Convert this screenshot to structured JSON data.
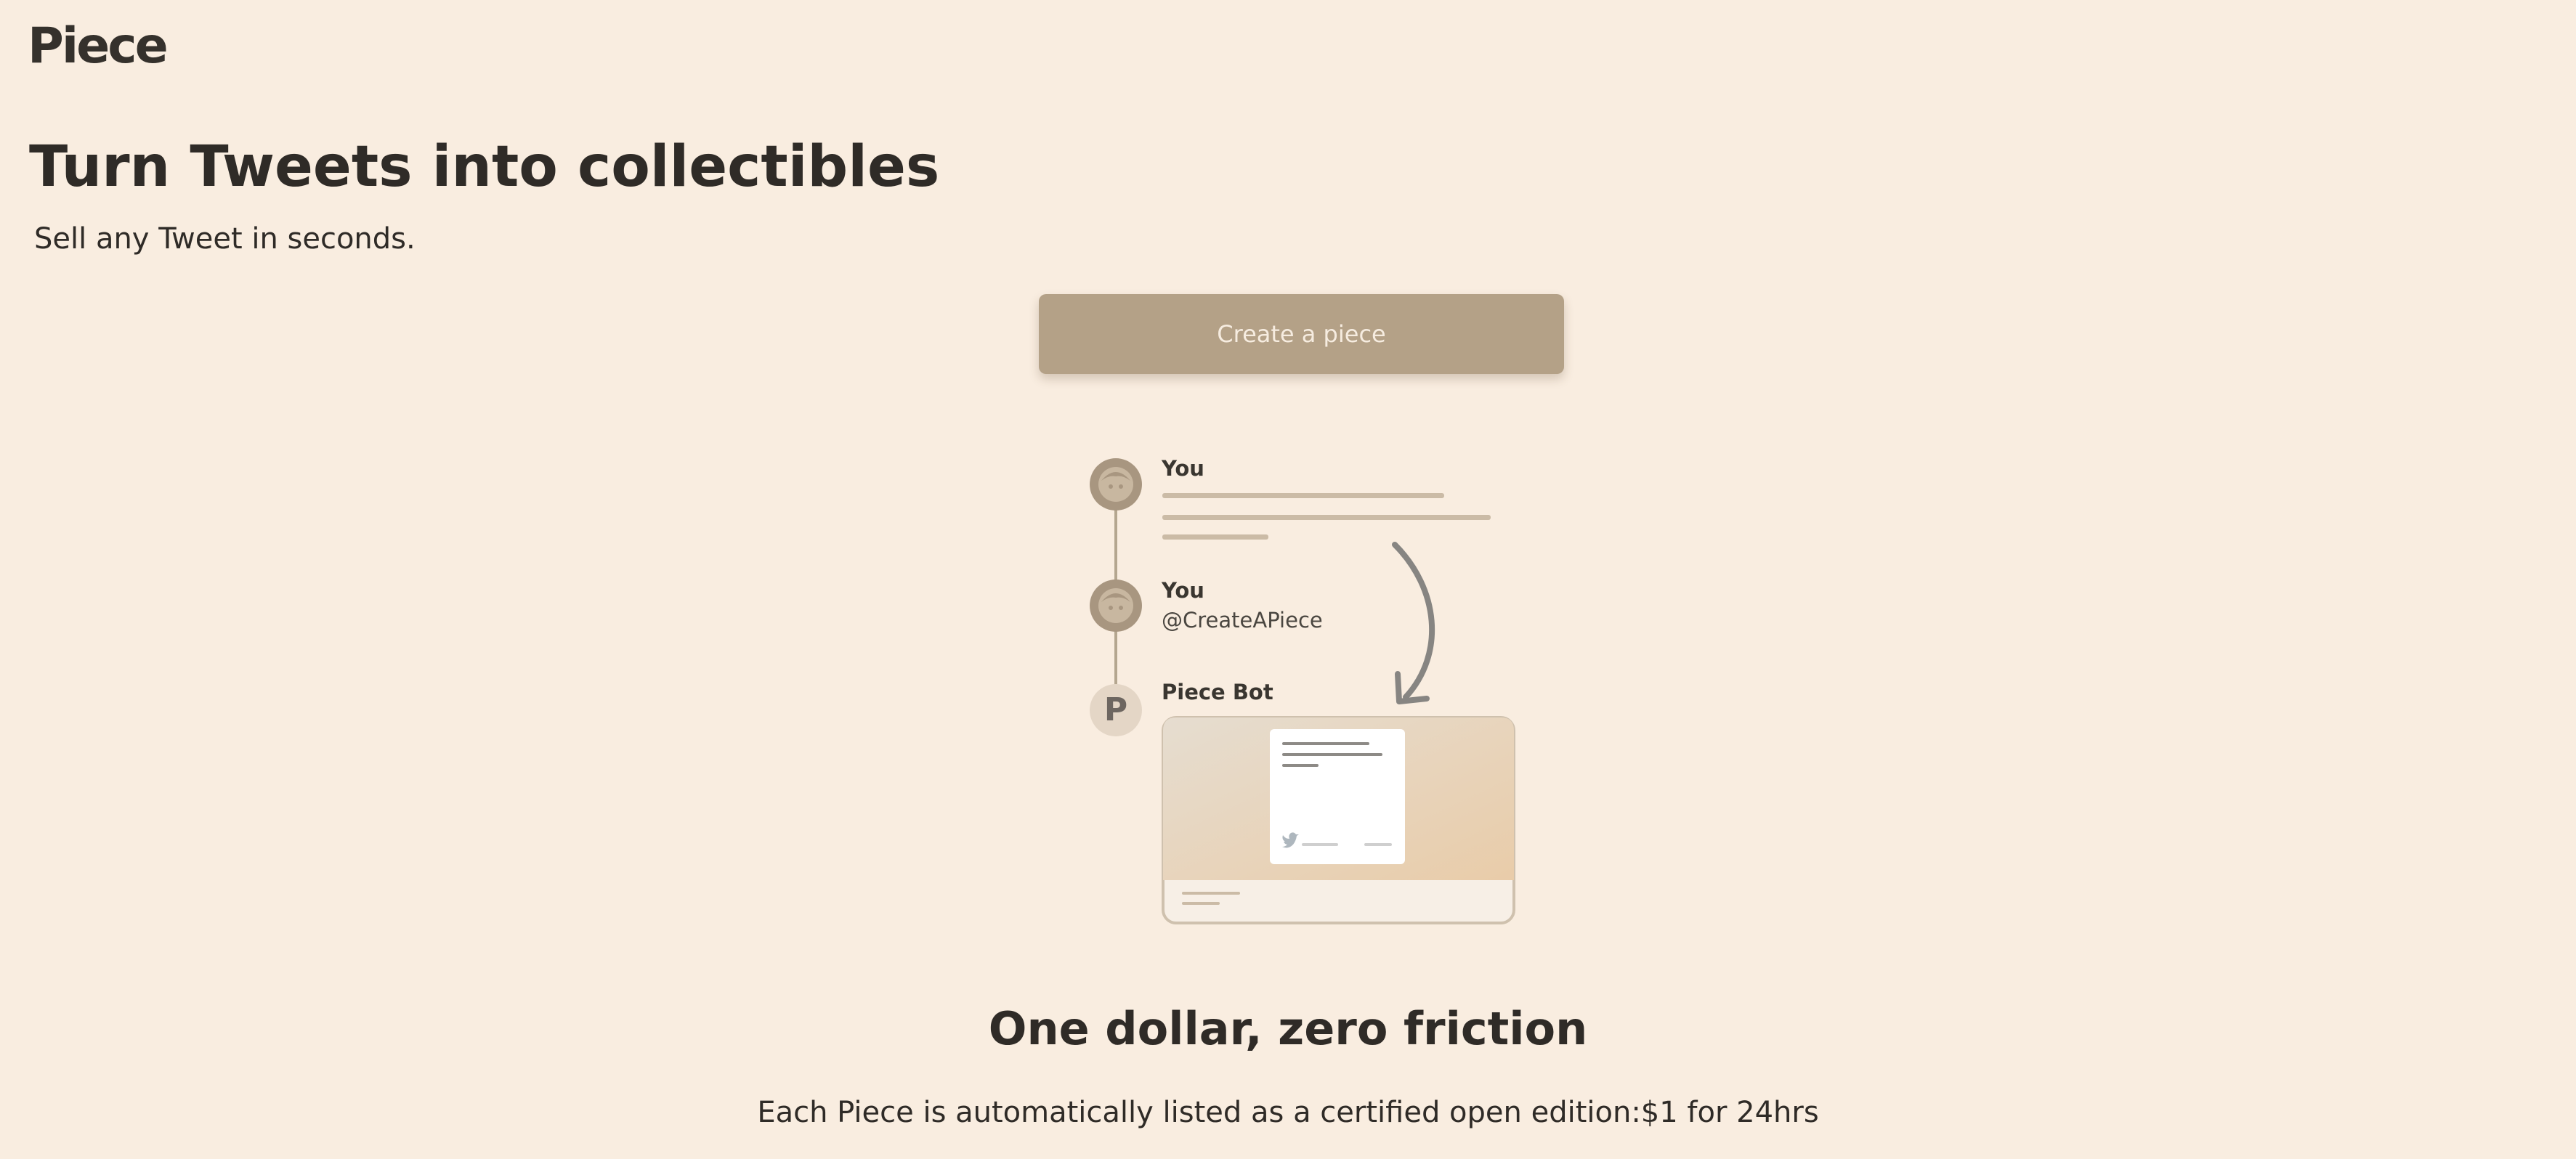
{
  "header": {
    "logo_text": "Piece"
  },
  "hero": {
    "title": "Turn Tweets into collectibles",
    "subtitle": "Sell any Tweet in seconds.",
    "cta_label": "Create a piece"
  },
  "illustration": {
    "tweet1_author": "You",
    "tweet2_author": "You",
    "tweet2_mention": "@CreateAPiece",
    "tweet3_author": "Piece Bot",
    "bot_avatar_letter": "P",
    "icons": [
      "user-avatar-icon",
      "piece-bot-avatar-icon",
      "curved-arrow-icon",
      "twitter-bird-icon"
    ]
  },
  "feature": {
    "title": "One dollar, zero friction",
    "description": "Each Piece is automatically listed as a certified open edition:$1 for 24hrs"
  },
  "colors": {
    "background": "#f9ede0",
    "cta_background": "#b4a187",
    "text": "#2f2b27"
  }
}
